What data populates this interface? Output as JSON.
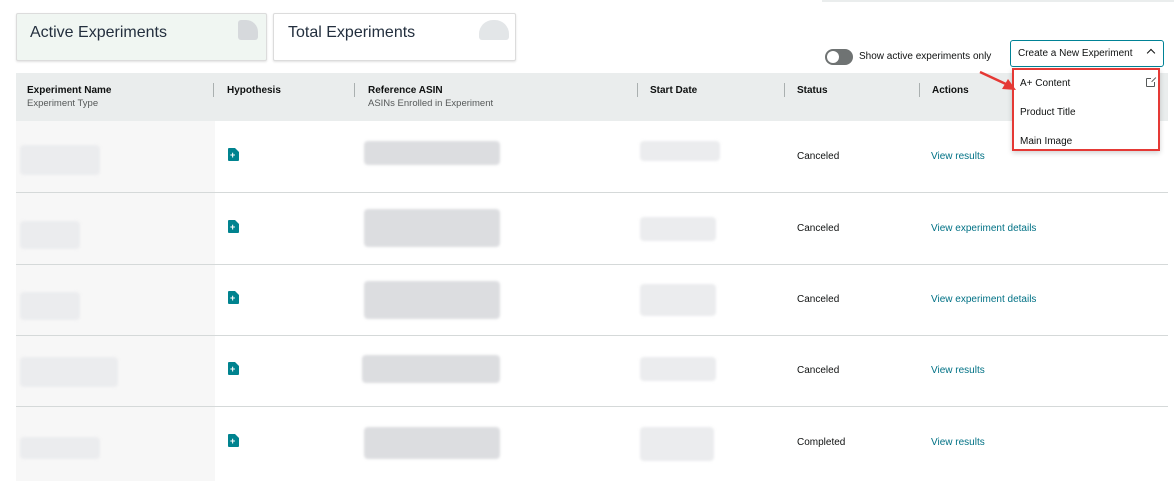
{
  "cards": {
    "active_title": "Active Experiments",
    "total_title": "Total Experiments"
  },
  "toolbar": {
    "toggle_label": "Show active experiments only",
    "toggle_on": false,
    "create_button": "Create a New Experiment"
  },
  "dropdown": {
    "items": [
      "A+ Content",
      "Product Title",
      "Main Image"
    ]
  },
  "table": {
    "headers": {
      "name": "Experiment Name",
      "name_sub": "Experiment Type",
      "hypothesis": "Hypothesis",
      "asin": "Reference ASIN",
      "asin_sub": "ASINs Enrolled in Experiment",
      "start": "Start Date",
      "status": "Status",
      "actions": "Actions"
    },
    "rows": [
      {
        "status": "Canceled",
        "action": "View results"
      },
      {
        "status": "Canceled",
        "action": "View experiment details"
      },
      {
        "status": "Canceled",
        "action": "View experiment details"
      },
      {
        "status": "Canceled",
        "action": "View results"
      },
      {
        "status": "Completed",
        "action": "View results"
      }
    ]
  },
  "colors": {
    "accent_teal": "#008296",
    "link": "#007185",
    "highlight_red": "#e53935"
  }
}
